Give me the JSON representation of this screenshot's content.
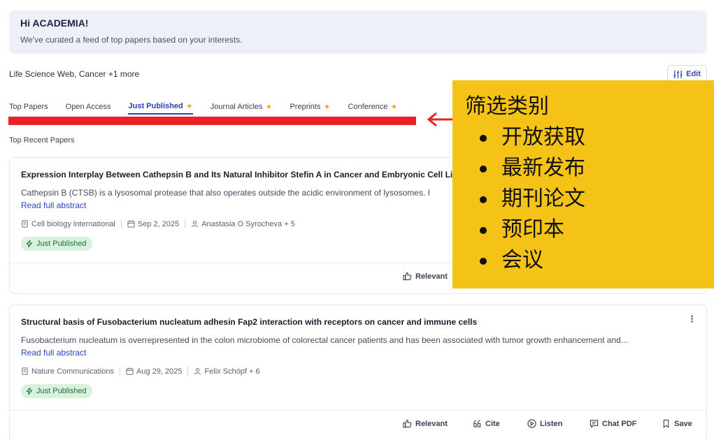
{
  "greeting": {
    "title": "Hi ACADEMIA!",
    "subtitle": "We've curated a feed of top papers based on your interests."
  },
  "interests": "Life Science Web, Cancer +1 more",
  "edit_label": "Edit",
  "tabs": [
    {
      "label": "Top Papers",
      "star": false,
      "active": false
    },
    {
      "label": "Open Access",
      "star": false,
      "active": false
    },
    {
      "label": "Just Published",
      "star": true,
      "active": true
    },
    {
      "label": "Journal Articles",
      "star": true,
      "active": false
    },
    {
      "label": "Preprints",
      "star": true,
      "active": false
    },
    {
      "label": "Conference",
      "star": true,
      "active": false
    }
  ],
  "star_glyph": "✦",
  "section_label": "Top Recent Papers",
  "papers": [
    {
      "title": "Expression Interplay Between Cathepsin B and Its Natural Inhibitor Stefin A in Cancer and Embryonic Cell Lines.",
      "abstract": "Cathepsin B (CTSB) is a lysosomal protease that also operates outside the acidic environment of lysosomes. I",
      "read_more": "Read full abstract",
      "journal": "Cell biology international",
      "date": "Sep 2, 2025",
      "authors": "Anastasia O Syrocheva + 5",
      "badge": "Just Published"
    },
    {
      "title": "Structural basis of Fusobacterium nucleatum adhesin Fap2 interaction with receptors on cancer and immune cells",
      "abstract": "Fusobacterium nucleatum is overrepresented in the colon microbiome of colorectal cancer patients and has been associated with tumor growth enhancement and...",
      "read_more": "Read full abstract",
      "journal": "Nature Communications",
      "date": "Aug 29, 2025",
      "authors": "Felix Schöpf + 6",
      "badge": "Just Published"
    }
  ],
  "actions": {
    "relevant": "Relevant",
    "cite": "Cite",
    "listen": "Listen",
    "chat_pdf": "Chat PDF",
    "save": "Save"
  },
  "kebab": "⋮",
  "annotation": {
    "title": "筛选类别",
    "items": [
      "开放获取",
      "最新发布",
      "期刊论文",
      "预印本",
      "会议"
    ]
  },
  "colors": {
    "accent": "#2c3fb0",
    "highlight_bar": "#ea2226",
    "overlay_bg": "#f5c317",
    "badge_bg": "#d7f2dd"
  }
}
